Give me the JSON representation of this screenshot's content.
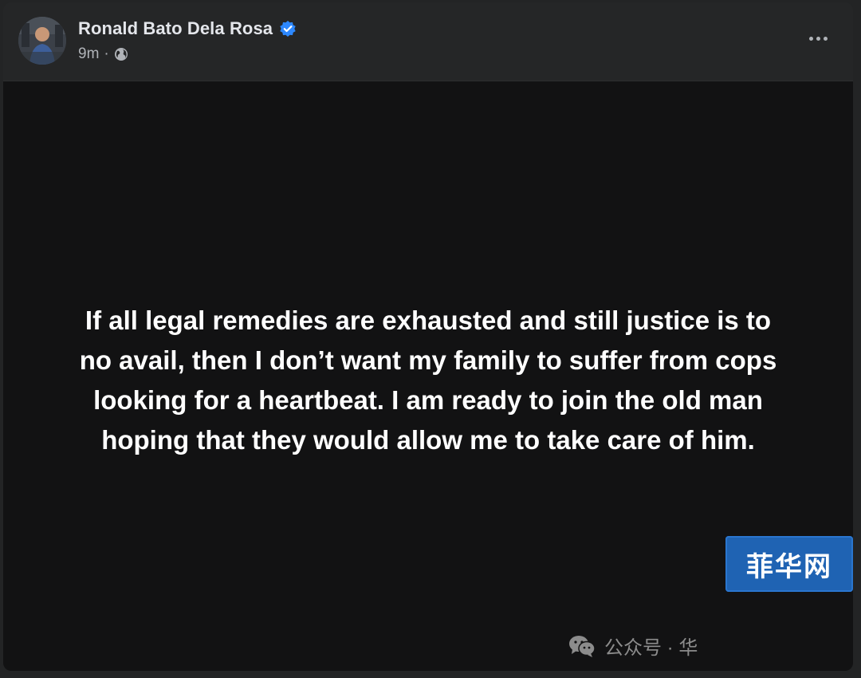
{
  "post": {
    "author_name": "Ronald Bato Dela Rosa",
    "verified": true,
    "timestamp": "9m",
    "separator": "·",
    "privacy_icon": "globe-icon",
    "more_icon": "more-options-icon",
    "text": "If all legal remedies are exhausted and still justice is to\nno avail, then I don’t want my family to suffer from cops\nlooking for a heartbeat. I am ready to join the old man\nhoping that they would allow me to take care of him."
  },
  "watermark": {
    "text": "公众号 · 华",
    "icon": "wechat-icon",
    "badge": "菲华网"
  },
  "colors": {
    "verified_badge": "#2d88ff",
    "post_background": "#121213",
    "header_background": "#252627",
    "badge_background": "#1f63b3"
  }
}
